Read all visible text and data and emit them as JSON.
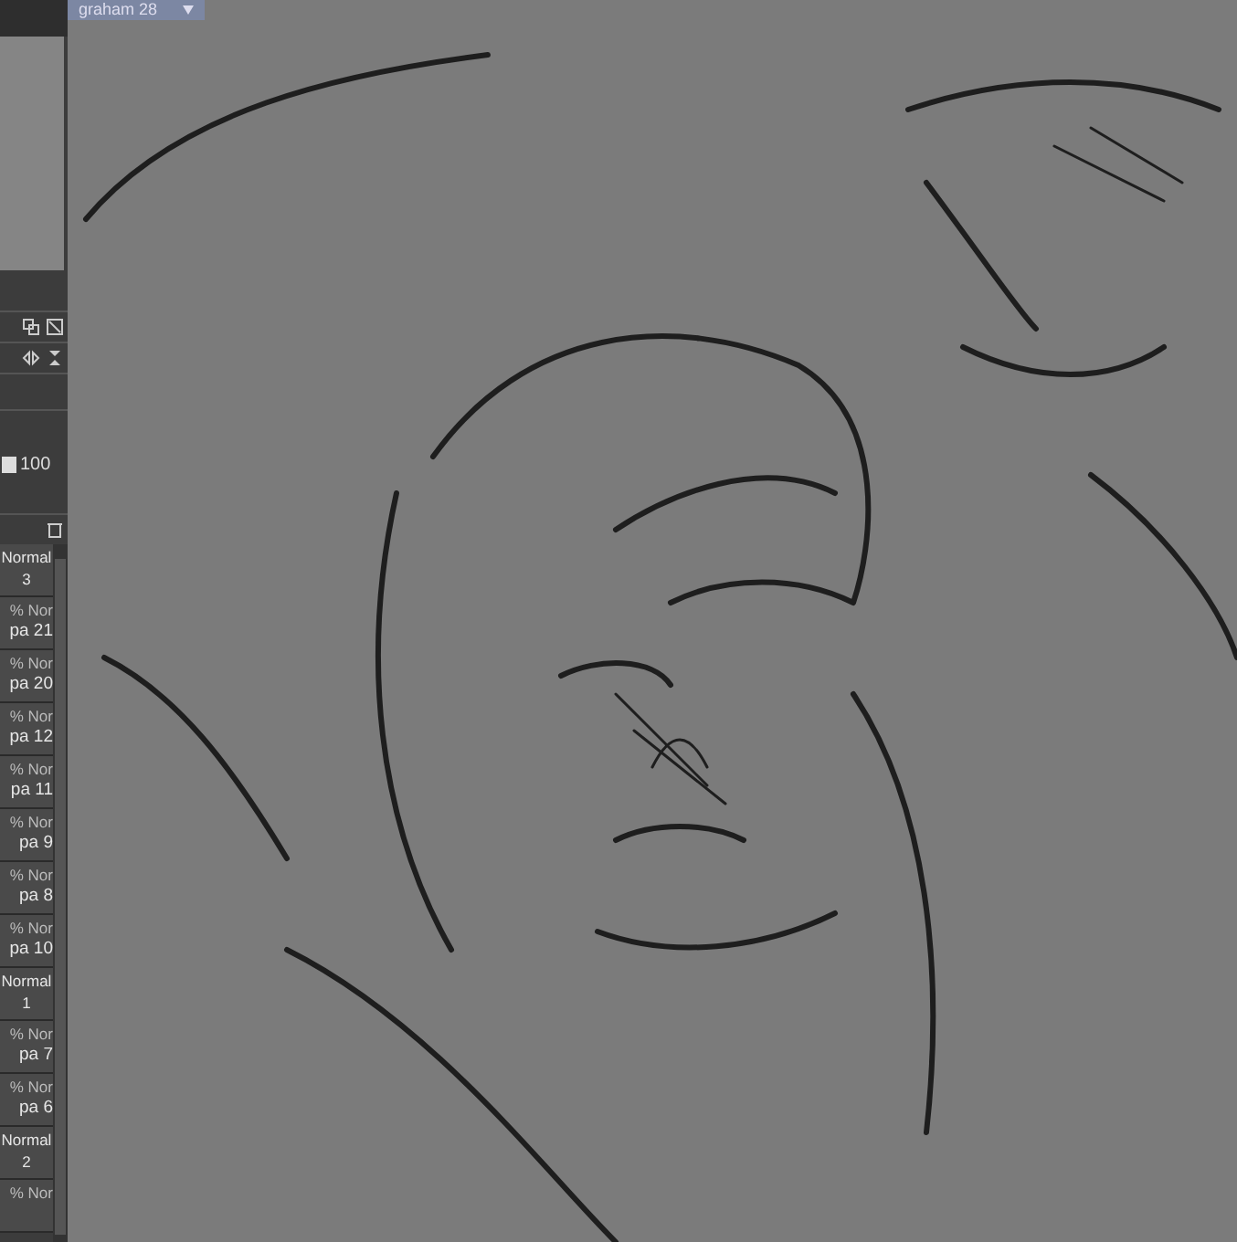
{
  "document_tab": {
    "title": "graham 28"
  },
  "layer_panel": {
    "opacity": "100",
    "opacity_slider": {
      "level": 1
    },
    "layers": [
      {
        "kind": "folder",
        "blend": "Normal",
        "name": "3"
      },
      {
        "kind": "layer",
        "blend": "% Nor",
        "name": "pa 21"
      },
      {
        "kind": "layer",
        "blend": "% Nor",
        "name": "pa 20"
      },
      {
        "kind": "layer",
        "blend": "% Nor",
        "name": "pa 12"
      },
      {
        "kind": "layer",
        "blend": "% Nor",
        "name": "pa 11"
      },
      {
        "kind": "layer",
        "blend": "% Nor",
        "name": "pa 9"
      },
      {
        "kind": "layer",
        "blend": "% Nor",
        "name": "pa 8"
      },
      {
        "kind": "layer",
        "blend": "% Nor",
        "name": "pa 10"
      },
      {
        "kind": "folder",
        "blend": "Normal",
        "name": "1"
      },
      {
        "kind": "layer",
        "blend": "% Nor",
        "name": "pa 7"
      },
      {
        "kind": "layer",
        "blend": "% Nor",
        "name": "pa 6"
      },
      {
        "kind": "folder",
        "blend": "Normal",
        "name": "2"
      },
      {
        "kind": "layer",
        "blend": "% Nor"
      }
    ]
  }
}
